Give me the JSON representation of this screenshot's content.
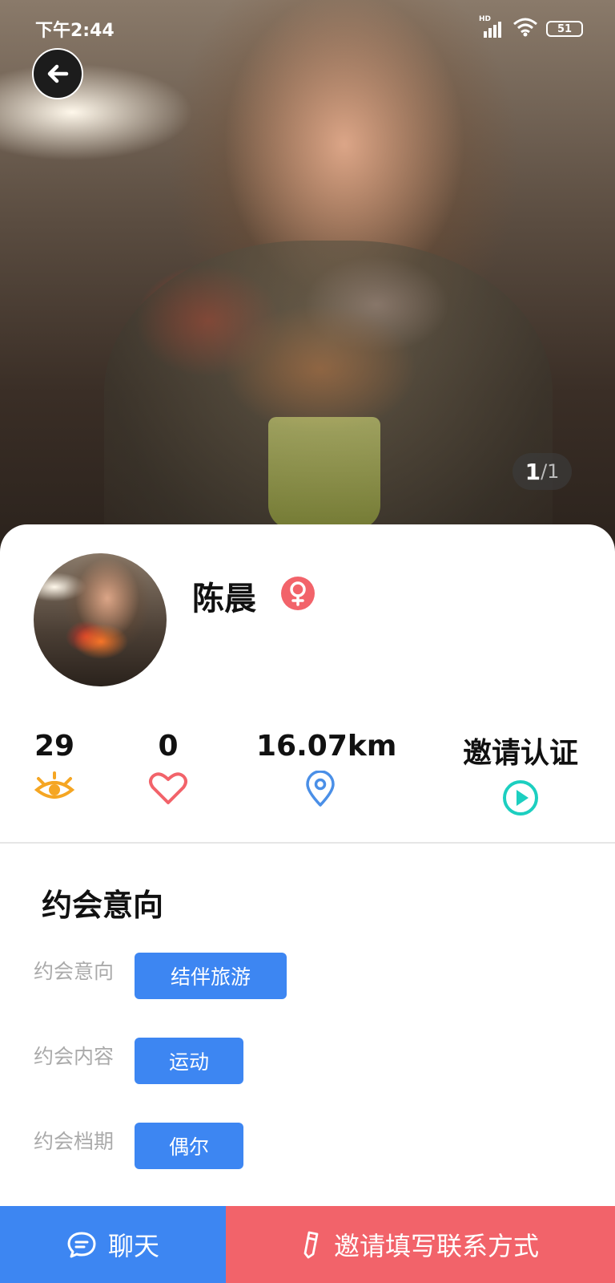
{
  "status_bar": {
    "time": "下午2:44",
    "network": "HD",
    "battery": "51"
  },
  "hero": {
    "counter_current": "1",
    "counter_total": "/1"
  },
  "profile": {
    "name": "陈晨",
    "gender": "female"
  },
  "stats": [
    {
      "value": "29",
      "icon": "eye-icon",
      "color": "#f5a623"
    },
    {
      "value": "0",
      "icon": "heart-icon",
      "color": "#f2636a"
    },
    {
      "value": "16.07km",
      "icon": "location-pin-icon",
      "color": "#4a8fe7"
    },
    {
      "value": "邀请认证",
      "icon": "play-circle-icon",
      "color": "#1ccfc0"
    }
  ],
  "dating": {
    "section_title": "约会意向",
    "rows": [
      {
        "label": "约会意向",
        "tag": "结伴旅游"
      },
      {
        "label": "约会内容",
        "tag": "运动"
      },
      {
        "label": "约会档期",
        "tag": "偶尔"
      }
    ]
  },
  "bottom": {
    "chat_label": "聊天",
    "invite_label": "邀请填写联系方式"
  },
  "colors": {
    "primary_blue": "#3d86f2",
    "accent_red": "#f2636a",
    "female_pink": "#f2636a"
  }
}
